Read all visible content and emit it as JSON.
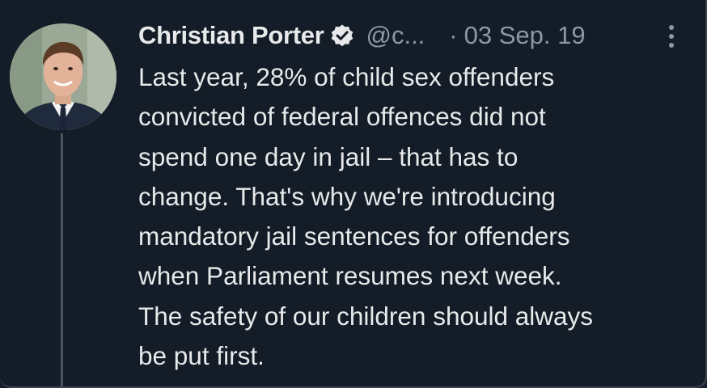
{
  "tweet": {
    "author_name": "Christian Porter",
    "handle": "@c...",
    "separator": "·",
    "date": "03 Sep. 19",
    "text_lines": [
      "Last year, 28% of child sex offenders",
      "convicted of federal offences did not",
      "spend one day in jail – that has to",
      "change. That's why we're introducing",
      "mandatory jail sentences for offenders",
      "when Parliament resumes next week.",
      "The safety of our children should always",
      "be put first."
    ]
  },
  "icons": {
    "verified": "verified-badge-icon",
    "more": "more-vertical-icon"
  },
  "colors": {
    "background": "#141d27",
    "text_primary": "#e7e9ea",
    "text_secondary": "#8b98a5",
    "thread_line": "#4a5561"
  }
}
